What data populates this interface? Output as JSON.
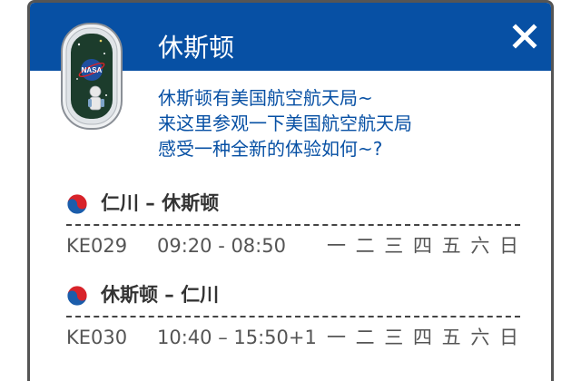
{
  "header": {
    "title": "休斯顿",
    "close_icon": "close-icon"
  },
  "description": {
    "lines": [
      "休斯顿有美国航空航天局~",
      "来这里参观一下美国航空航天局",
      "感受一种全新的体验如何~?"
    ]
  },
  "illustration": {
    "badge_text": "NASA"
  },
  "routes": [
    {
      "title": "仁川 – 休斯顿",
      "flight_no": "KE029",
      "time": "09:20 - 08:50",
      "days": "一 二 三 四 五 六 日"
    },
    {
      "title": "休斯顿 – 仁川",
      "flight_no": "KE030",
      "time": "10:40 – 15:50+1",
      "days": "一 二 三 四 五 六 日"
    }
  ],
  "colors": {
    "header_bg": "#0750a4",
    "text_accent": "#0750a4",
    "border": "#555555",
    "flag_red": "#d8232a",
    "flag_blue": "#1b5dab"
  }
}
